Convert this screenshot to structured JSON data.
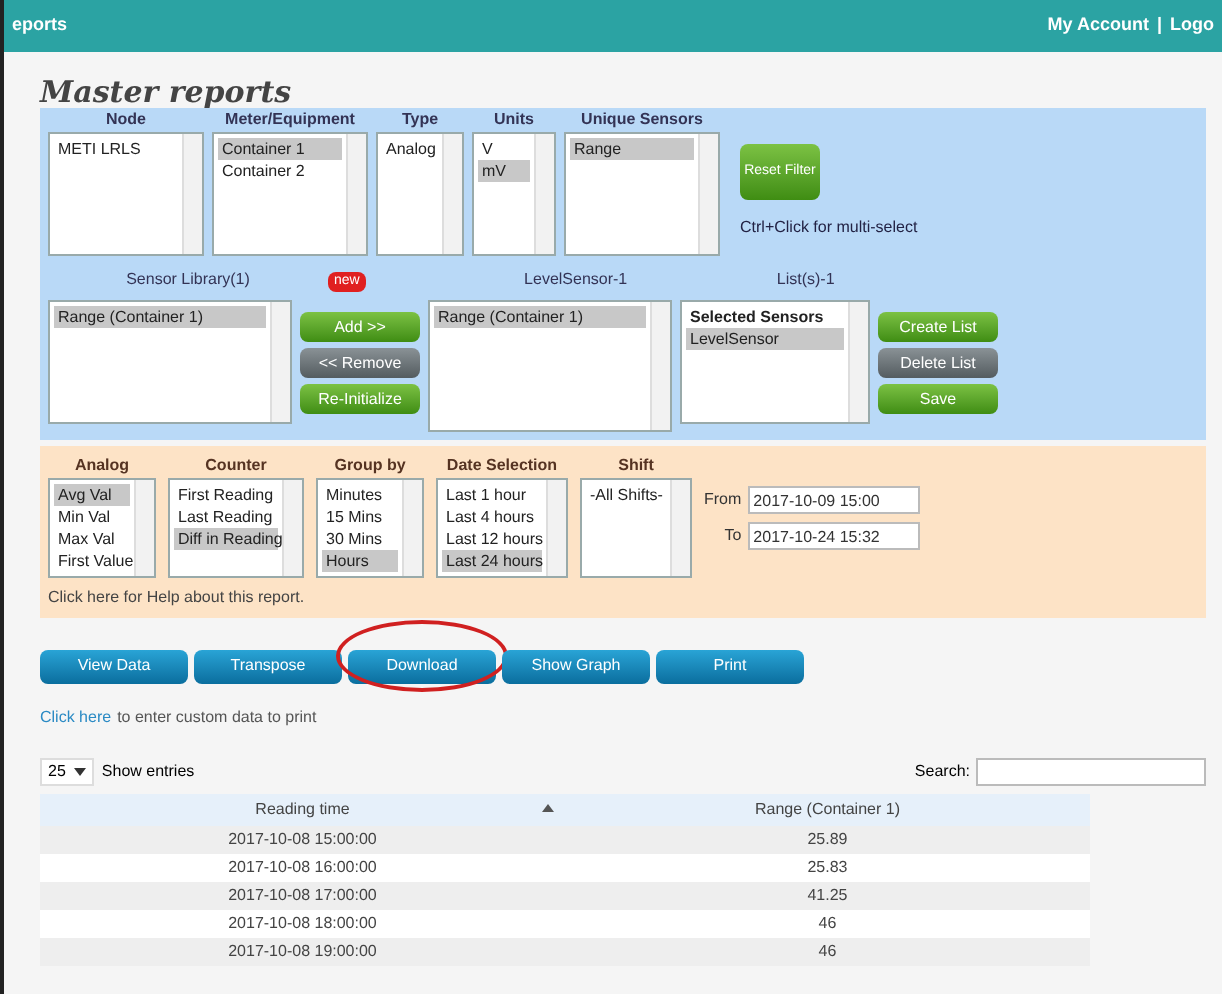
{
  "header": {
    "title": "eports",
    "account": "My Account",
    "separator": "|",
    "logout": "Logo"
  },
  "page_title": "Master reports",
  "filters": [
    {
      "label": "Node",
      "items": [
        {
          "label": "METI LRLS",
          "selected": false
        }
      ]
    },
    {
      "label": "Meter/Equipment",
      "items": [
        {
          "label": "Container 1",
          "selected": true
        },
        {
          "label": "Container 2",
          "selected": false
        }
      ]
    },
    {
      "label": "Type",
      "items": [
        {
          "label": "Analog",
          "selected": false
        }
      ]
    },
    {
      "label": "Units",
      "items": [
        {
          "label": "V",
          "selected": false
        },
        {
          "label": "mV",
          "selected": true
        }
      ]
    },
    {
      "label": "Unique Sensors",
      "items": [
        {
          "label": "Range",
          "selected": true
        }
      ]
    }
  ],
  "reset_button": "Reset Filter",
  "hint": "Ctrl+Click for multi-select",
  "sensor_library": {
    "label": "Sensor Library(1)",
    "badge": "new",
    "items": [
      {
        "label": "Range (Container 1)",
        "selected": true
      }
    ]
  },
  "move_buttons": [
    {
      "label": "Add >>",
      "kind": "green"
    },
    {
      "label": "<< Remove",
      "kind": "grey"
    },
    {
      "label": "Re-Initialize",
      "kind": "green"
    }
  ],
  "level_sensor": {
    "label": "LevelSensor-1",
    "items": [
      {
        "label": "Range (Container 1)",
        "selected": true
      }
    ]
  },
  "lists": {
    "label": "List(s)-1",
    "items": [
      {
        "label": "Selected Sensors",
        "selected": false,
        "kind": "header"
      },
      {
        "label": "LevelSensor",
        "selected": true,
        "kind": "item"
      }
    ]
  },
  "list_buttons": [
    {
      "label": "Create List",
      "kind": "green"
    },
    {
      "label": "Delete List",
      "kind": "grey"
    },
    {
      "label": "Save",
      "kind": "green"
    }
  ],
  "options": [
    {
      "label": "Analog",
      "items": [
        {
          "label": "Avg Val",
          "selected": true
        },
        {
          "label": "Min Val",
          "selected": false
        },
        {
          "label": "Max Val",
          "selected": false
        },
        {
          "label": "First Value",
          "selected": false
        }
      ]
    },
    {
      "label": "Counter",
      "items": [
        {
          "label": "First Reading",
          "selected": false
        },
        {
          "label": "Last Reading",
          "selected": false
        },
        {
          "label": "Diff in Reading",
          "selected": true
        }
      ]
    },
    {
      "label": "Group by",
      "items": [
        {
          "label": "Minutes",
          "selected": false
        },
        {
          "label": "15 Mins",
          "selected": false
        },
        {
          "label": "30 Mins",
          "selected": false
        },
        {
          "label": "Hours",
          "selected": true
        }
      ]
    },
    {
      "label": "Date Selection",
      "items": [
        {
          "label": "Last 1 hour",
          "selected": false
        },
        {
          "label": "Last 4 hours",
          "selected": false
        },
        {
          "label": "Last 12 hours",
          "selected": false
        },
        {
          "label": "Last 24 hours",
          "selected": true
        }
      ]
    },
    {
      "label": "Shift",
      "items": [
        {
          "label": "-All Shifts-",
          "selected": false
        }
      ]
    }
  ],
  "from": {
    "label": "From",
    "value": "2017-10-09 15:00"
  },
  "to": {
    "label": "To",
    "value": "2017-10-24 15:32"
  },
  "help_link": "Click here for Help about this report.",
  "actions": [
    {
      "label": "View Data",
      "circled": false
    },
    {
      "label": "Transpose",
      "circled": false
    },
    {
      "label": "Download",
      "circled": true
    },
    {
      "label": "Show Graph",
      "circled": false
    },
    {
      "label": "Print",
      "circled": false
    }
  ],
  "custom_link": "Click here",
  "custom_text": "to enter custom data to print",
  "page_size": "25",
  "show_entries": "Show entries",
  "search_label": "Search:",
  "table": {
    "columns": [
      "Reading time",
      "Range (Container 1)"
    ],
    "rows": [
      [
        "2017-10-08 15:00:00",
        "25.89"
      ],
      [
        "2017-10-08 16:00:00",
        "25.83"
      ],
      [
        "2017-10-08 17:00:00",
        "41.25"
      ],
      [
        "2017-10-08 18:00:00",
        "46"
      ],
      [
        "2017-10-08 19:00:00",
        "46"
      ]
    ]
  }
}
